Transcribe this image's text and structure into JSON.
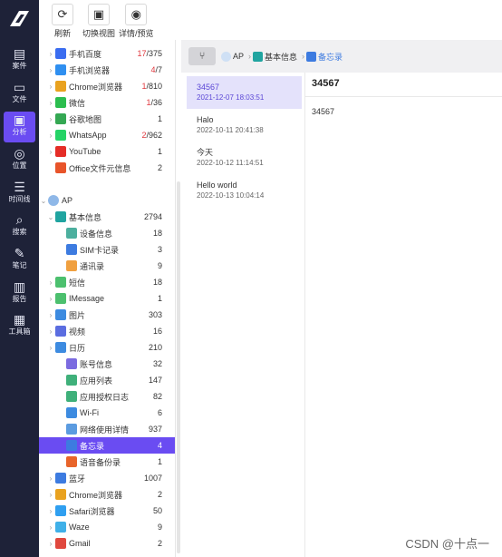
{
  "rail": [
    {
      "label": "案件",
      "icon": "case-icon"
    },
    {
      "label": "文件",
      "icon": "folder-icon"
    },
    {
      "label": "分析",
      "icon": "analysis-icon",
      "active": true
    },
    {
      "label": "位置",
      "icon": "location-icon"
    },
    {
      "label": "时间线",
      "icon": "timeline-icon"
    },
    {
      "label": "搜索",
      "icon": "search-icon"
    },
    {
      "label": "笔记",
      "icon": "note-icon"
    },
    {
      "label": "报告",
      "icon": "report-icon"
    },
    {
      "label": "工具箱",
      "icon": "toolbox-icon"
    }
  ],
  "toolbar": {
    "refresh_label": "刷新",
    "switch_view_label": "切换视图",
    "detail_preview_label": "详情/预览"
  },
  "tree": {
    "rows": [
      {
        "name": "手机百度",
        "count_red": "17",
        "count": "/375",
        "color": "#3b6df0"
      },
      {
        "name": "手机浏览器",
        "count_red": "4",
        "count": "/7",
        "color": "#2f8ff0"
      },
      {
        "name": "Chrome浏览器",
        "count_red": "1",
        "count": "/810",
        "color": "#e9a21f"
      },
      {
        "name": "微信",
        "count_red": "1",
        "count": "/36",
        "color": "#2bbd4e"
      },
      {
        "name": "谷歌地图",
        "count_red": "",
        "count": "1",
        "color": "#34a853"
      },
      {
        "name": "WhatsApp",
        "count_red": "2",
        "count": "/962",
        "color": "#25d366"
      },
      {
        "name": "YouTube",
        "count_red": "",
        "count": "1",
        "color": "#e52d27"
      },
      {
        "name": "Office文件元信息",
        "count_red": "",
        "count": "2",
        "color": "#e8542a"
      },
      {
        "name": "AP",
        "count_red": "",
        "count": "",
        "color": "#8fb8e8"
      },
      {
        "name": "基本信息",
        "count_red": "",
        "count": "2794",
        "color": "#20a4a0"
      },
      {
        "name": "设备信息",
        "count_red": "",
        "count": "18",
        "color": "#4caf9e"
      },
      {
        "name": "SIM卡记录",
        "count_red": "",
        "count": "3",
        "color": "#3d7be0"
      },
      {
        "name": "通讯录",
        "count_red": "",
        "count": "9",
        "color": "#f0a040"
      },
      {
        "name": "短信",
        "count_red": "",
        "count": "18",
        "color": "#4cc06e"
      },
      {
        "name": "IMessage",
        "count_red": "",
        "count": "1",
        "color": "#4cc06e"
      },
      {
        "name": "图片",
        "count_red": "",
        "count": "303",
        "color": "#3d8be0"
      },
      {
        "name": "视频",
        "count_red": "",
        "count": "16",
        "color": "#5b6de0"
      },
      {
        "name": "日历",
        "count_red": "",
        "count": "210",
        "color": "#3d8be0"
      },
      {
        "name": "账号信息",
        "count_red": "",
        "count": "32",
        "color": "#7b6be0"
      },
      {
        "name": "应用列表",
        "count_red": "",
        "count": "147",
        "color": "#3fb07a"
      },
      {
        "name": "应用授权日志",
        "count_red": "",
        "count": "82",
        "color": "#3fb07a"
      },
      {
        "name": "Wi-Fi",
        "count_red": "",
        "count": "6",
        "color": "#3d8be0"
      },
      {
        "name": "网络使用详情",
        "count_red": "",
        "count": "937",
        "color": "#5b9be0"
      },
      {
        "name": "备忘录",
        "count_red": "",
        "count": "4",
        "color": "#3d7be0",
        "selected": true
      },
      {
        "name": "语音备份录",
        "count_red": "",
        "count": "1",
        "color": "#e8642a"
      },
      {
        "name": "蓝牙",
        "count_red": "",
        "count": "1007",
        "color": "#3d7be0"
      },
      {
        "name": "Chrome浏览器",
        "count_red": "",
        "count": "2",
        "color": "#e9a21f"
      },
      {
        "name": "Safari浏览器",
        "count_red": "",
        "count": "50",
        "color": "#2f9ff0"
      },
      {
        "name": "Waze",
        "count_red": "",
        "count": "9",
        "color": "#3fb0e8"
      },
      {
        "name": "Gmail",
        "count_red": "",
        "count": "2",
        "color": "#e0483e"
      }
    ]
  },
  "breadcrumb": {
    "device": "AP",
    "group": "基本信息",
    "current": "备忘录"
  },
  "notes": [
    {
      "title": "34567",
      "date": "2021-12-07 18:03:51"
    },
    {
      "title": "Halo",
      "date": "2022-10-11 20:41:38"
    },
    {
      "title": "今天",
      "date": "2022-10-12 11:14:51"
    },
    {
      "title": "Hello world",
      "date": "2022-10-13 10:04:14"
    }
  ],
  "detail": {
    "title": "34567",
    "body": "34567"
  },
  "watermark": "CSDN @十点一"
}
